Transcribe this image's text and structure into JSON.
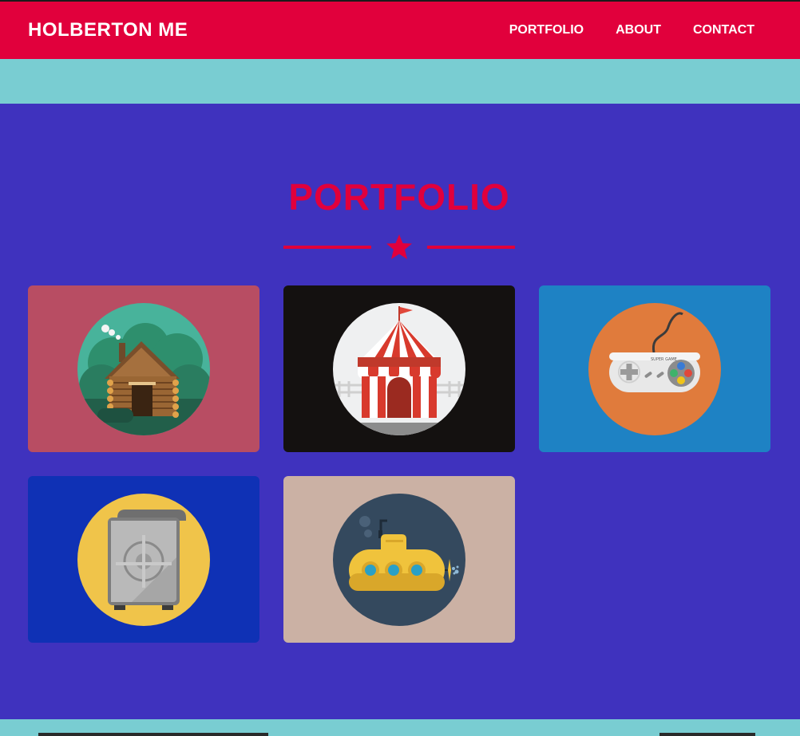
{
  "navbar": {
    "brand": "HOLBERTON ME",
    "links": [
      "PORTFOLIO",
      "ABOUT",
      "CONTACT"
    ]
  },
  "portfolio": {
    "title": "PORTFOLIO",
    "divider_icon": "star-icon",
    "items": [
      {
        "icon": "log-cabin-icon",
        "bg": "#b84d63"
      },
      {
        "icon": "circus-tent-icon",
        "bg": "#141110"
      },
      {
        "icon": "game-controller-icon",
        "bg": "#1e82c4",
        "controller_text": "SUPER GAME"
      },
      {
        "icon": "safe-icon",
        "bg": "#0f31b5"
      },
      {
        "icon": "submarine-icon",
        "bg": "#cbb1a4"
      }
    ]
  },
  "colors": {
    "accent": "#e1003c",
    "background": "#3f32be",
    "strip": "#79cdd2",
    "text_light": "#ffffff"
  }
}
